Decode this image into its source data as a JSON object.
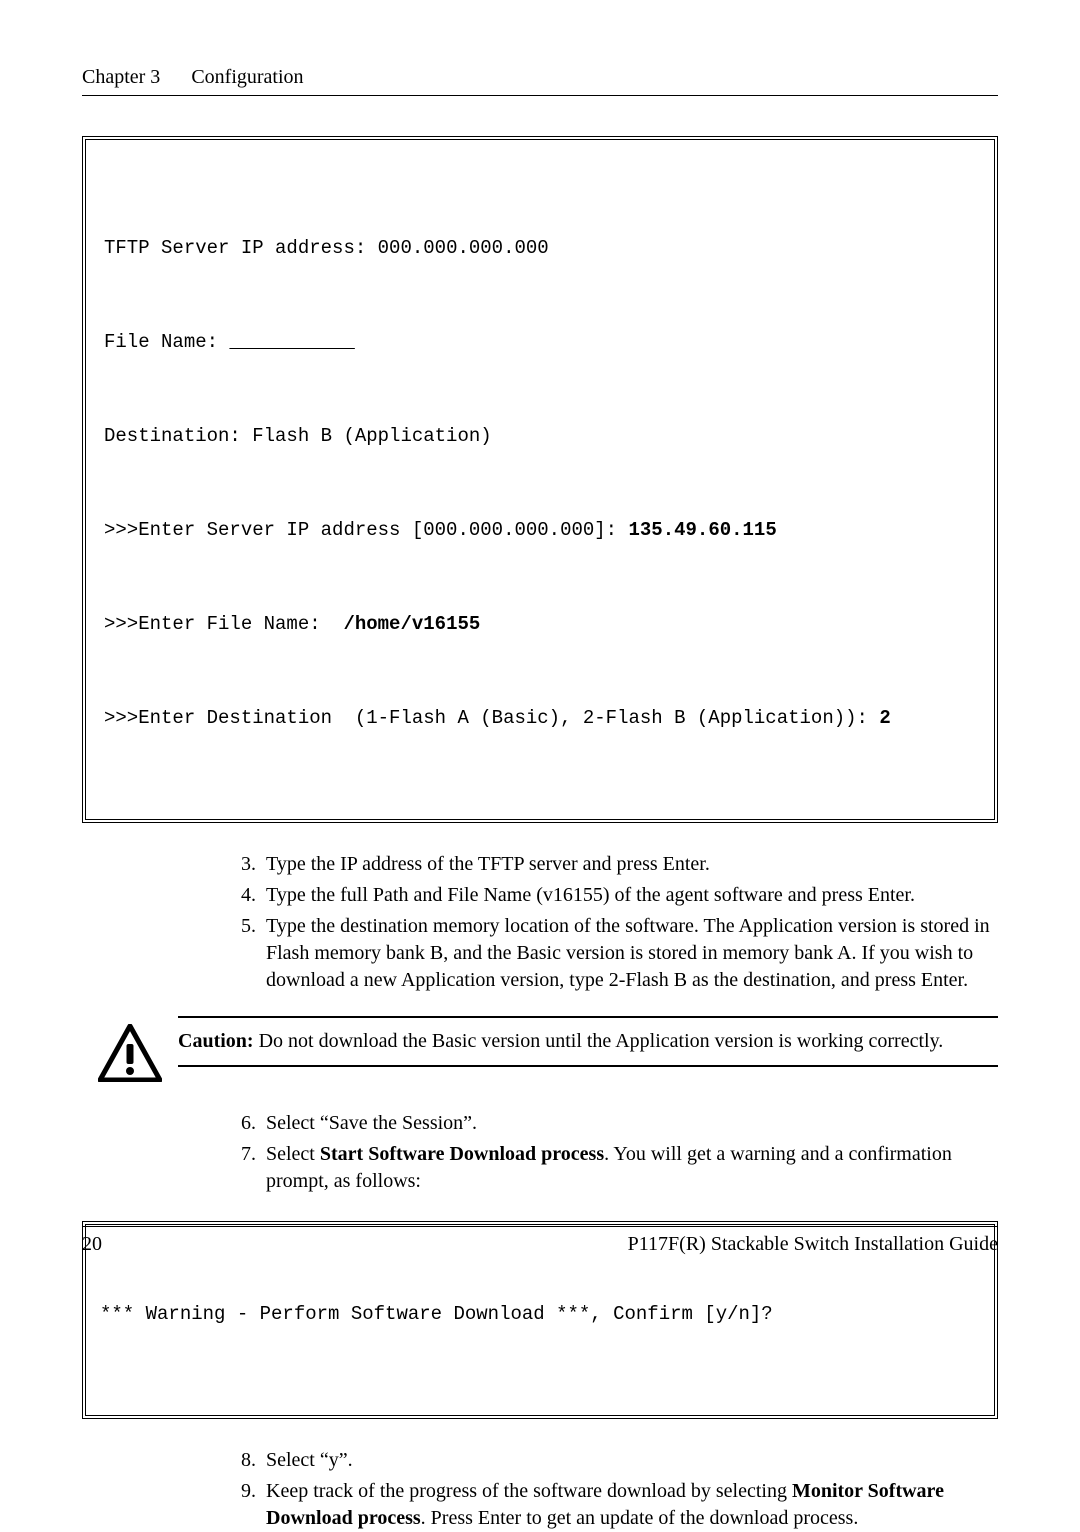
{
  "header": {
    "chapter": "Chapter 3",
    "title": "Configuration"
  },
  "terminal1": {
    "line1_prefix": "TFTP Server IP address: ",
    "line1_value": "000.000.000.000",
    "line2_prefix": "File Name: ",
    "line2_blank": "           ",
    "line3": "Destination: Flash B (Application)",
    "line4a": ">>>Enter Server IP address [000.000.000.000]: ",
    "line4b": "135.49.60.115",
    "line5a": ">>>Enter File Name:  ",
    "line5b": "/home/v16155",
    "line6a": ">>>Enter Destination  (1-Flash A (Basic), 2-Flash B (Application)): ",
    "line6b": "2"
  },
  "steps_a": [
    {
      "num": "3.",
      "text": "Type the IP address of the TFTP server and press Enter."
    },
    {
      "num": "4.",
      "text": "Type the full Path and File Name (v16155) of the agent software and press Enter."
    },
    {
      "num": "5.",
      "text": "Type the destination memory location of the software. The Application version is stored in Flash memory bank B, and the Basic version is stored in memory bank A. If you wish to download a new Application version, type 2-Flash B as the destination, and press Enter."
    }
  ],
  "caution": {
    "label": "Caution:",
    "text": " Do not download the Basic version until the Application version is working correctly."
  },
  "steps_b": [
    {
      "num": "6.",
      "parts": [
        {
          "t": "Select “Save the Session”."
        }
      ]
    },
    {
      "num": "7.",
      "parts": [
        {
          "t": "Select "
        },
        {
          "t": "Start Software Download process",
          "b": true
        },
        {
          "t": ". You will get a warning and a confirmation prompt, as follows:"
        }
      ]
    }
  ],
  "terminal2": {
    "line": "*** Warning - Perform Software Download ***, Confirm [y/n]?"
  },
  "steps_c": [
    {
      "num": "8.",
      "parts": [
        {
          "t": "Select “y”."
        }
      ]
    },
    {
      "num": "9.",
      "parts": [
        {
          "t": "Keep track of the progress of the software download by selecting "
        },
        {
          "t": "Monitor Software Download process",
          "b": true
        },
        {
          "t": ". Press Enter to get an update of the download process."
        }
      ]
    }
  ],
  "footer": {
    "page": "20",
    "title": "P117F(R) Stackable Switch Installation Guide"
  }
}
